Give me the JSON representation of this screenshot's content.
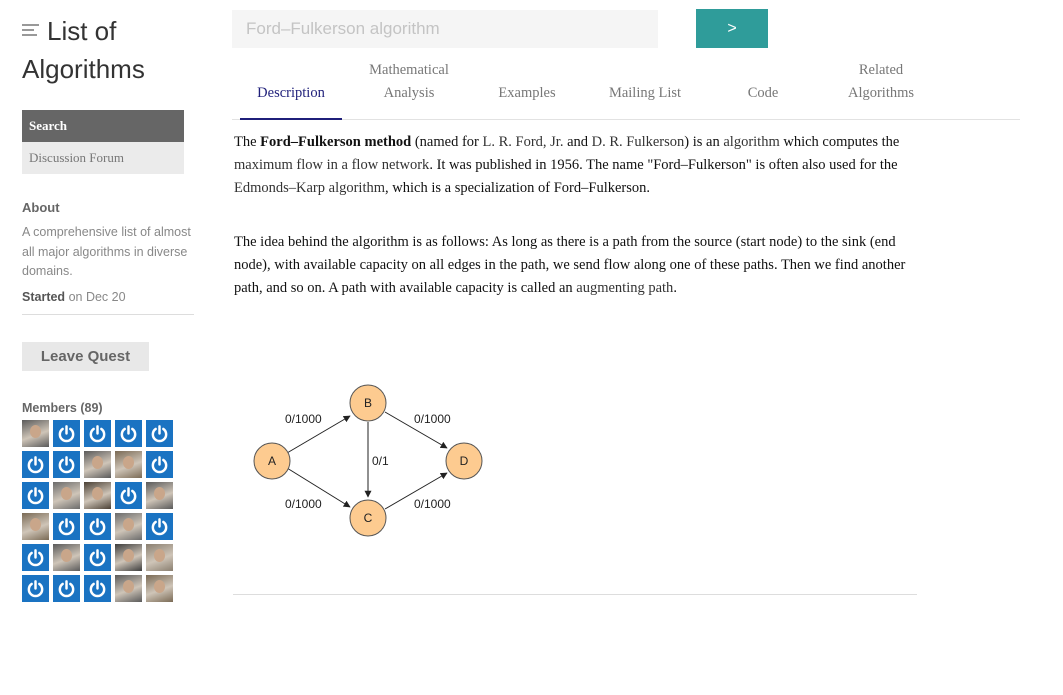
{
  "sidebar": {
    "title_line1": "List of",
    "title_line2": "Algorithms",
    "nav": [
      {
        "label": "Search"
      },
      {
        "label": "Discussion Forum"
      }
    ],
    "about_heading": "About",
    "about_text": "A comprehensive list of almost all major algorithms in diverse domains.",
    "started_label": "Started",
    "started_date": "on Dec 20",
    "leave_label": "Leave Quest",
    "members_label": "Members (89)"
  },
  "search": {
    "placeholder": "Ford–Fulkerson algorithm",
    "button_label": ">"
  },
  "tabs": [
    {
      "label": "Description"
    },
    {
      "label_line1": "Mathematical",
      "label_line2": "Analysis"
    },
    {
      "label": "Examples"
    },
    {
      "label": "Mailing List"
    },
    {
      "label": "Code"
    },
    {
      "label_line1": "Related",
      "label_line2": "Algorithms"
    }
  ],
  "article": {
    "p1_pre": "The ",
    "p1_bold": "Ford–Fulkerson method",
    "p1_mid1": " (named for ",
    "p1_link_ford": "L. R. Ford, Jr.",
    "p1_mid2": " and ",
    "p1_link_fulkerson": "D. R. Fulkerson",
    "p1_mid3": ") is an ",
    "p1_link_algorithm": "algorithm",
    "p1_mid4": " which computes the ",
    "p1_link_maxflow": "maximum flow in a flow network",
    "p1_mid5": ". It was published in 1956. The name \"Ford–Fulkerson\" is often also used for the ",
    "p1_link_edmonds": "Edmonds–Karp algorithm",
    "p1_post": ", which is a specialization of Ford–Fulkerson.",
    "p2_pre": "The idea behind the algorithm is as follows: As long as there is a path from the source (start node) to the sink (end node), with available capacity on all edges in the path, we send flow along one of these paths. Then we find another path, and so on. A path with available capacity is called an ",
    "p2_link": "augmenting path",
    "p2_post": "."
  },
  "graph": {
    "nodes": [
      "A",
      "B",
      "C",
      "D"
    ],
    "edge_labels": {
      "ab": "0/1000",
      "bd": "0/1000",
      "ac": "0/1000",
      "cd": "0/1000",
      "bc": "0/1"
    },
    "node_fill": "#fdcb90"
  },
  "colors": {
    "accent": "#2f9c9a",
    "avatar_blue": "#1a73c2",
    "active_tab": "#1f1f7a",
    "nav_active": "#666666"
  },
  "members": [
    "photo",
    "power",
    "power",
    "power",
    "power",
    "power",
    "power",
    "photo",
    "photo",
    "power",
    "power",
    "photo",
    "photo",
    "power",
    "photo",
    "photo",
    "power",
    "power",
    "photo",
    "power",
    "power",
    "photo",
    "power",
    "photo",
    "photo",
    "power",
    "power",
    "power",
    "photo",
    "photo"
  ]
}
